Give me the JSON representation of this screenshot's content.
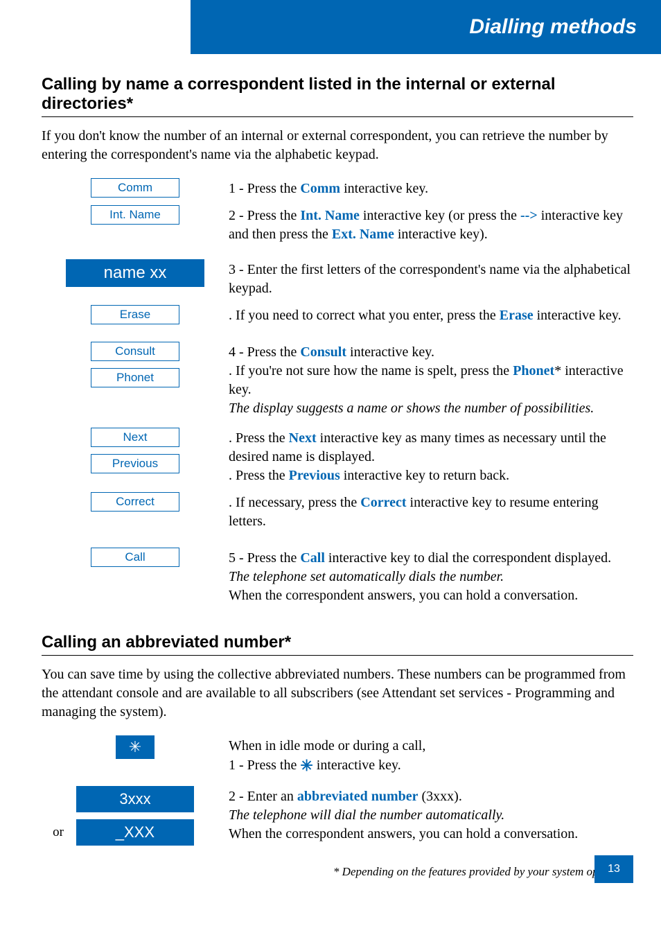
{
  "header": {
    "title": "Dialling methods"
  },
  "section1": {
    "heading": "Calling by name a correspondent listed in the internal or external directories*",
    "intro": "If you don't know the number of an internal or external correspondent, you can retrieve the number by entering the correspondent's name via the alphabetic keypad.",
    "keys": {
      "comm": "Comm",
      "int_name": "Int. Name",
      "name_display": "name xx",
      "erase": "Erase",
      "consult": "Consult",
      "phonet": "Phonet",
      "next": "Next",
      "previous": "Previous",
      "correct": "Correct",
      "call": "Call"
    },
    "steps": {
      "s1_a": "1 - Press the ",
      "s1_key": "Comm",
      "s1_b": " interactive key.",
      "s2_a": "2 - Press the ",
      "s2_key1": "Int. Name",
      "s2_b": " interactive key (or press the ",
      "s2_key2": "-->",
      "s2_c": " interactive key and then press the ",
      "s2_key3": "Ext. Name",
      "s2_d": " interactive key).",
      "s3": "3 - Enter the first letters of the correspondent's name via the alphabetical keypad.",
      "s3b_a": ". If you need to correct what you enter, press the ",
      "s3b_key": "Erase",
      "s3b_b": " interactive key.",
      "s4_a": "4 - Press the ",
      "s4_key1": "Consult",
      "s4_b": " interactive key.",
      "s4_c": ". If you're not sure how the name is spelt, press the ",
      "s4_key2": "Phonet",
      "s4_d": "* interactive key.",
      "s4_it": "The display suggests a name or shows the number of possibilities.",
      "s5_a": ". Press the ",
      "s5_key1": "Next",
      "s5_b": " interactive key as many times as necessary until the desired name is displayed.",
      "s5_c": ". Press the ",
      "s5_key2": "Previous",
      "s5_d": " interactive key to return back.",
      "s6_a": ". If necessary, press the ",
      "s6_key": "Correct",
      "s6_b": " interactive key to resume entering letters.",
      "s7_a": "5 - Press the ",
      "s7_key": "Call",
      "s7_b": " interactive key to dial the correspondent displayed.",
      "s7_it": "The telephone set automatically dials the number.",
      "s7_c": "When the correspondent answers, you can hold a conversation."
    }
  },
  "section2": {
    "heading": "Calling an abbreviated number*",
    "intro": "You can save time by using the collective abbreviated numbers. These numbers can be programmed from the attendant console and are available to all subscribers (see Attendant set services - Programming and managing the system).",
    "keys": {
      "star": "✳",
      "three": "3xxx",
      "or_label": "or",
      "underscore": "_XXX"
    },
    "steps": {
      "s1_a": "When in idle mode or during a call,",
      "s1_b": "1 - Press the ",
      "s1_star": "✳",
      "s1_c": " interactive key.",
      "s2_a": "2 - Enter an ",
      "s2_key": "abbreviated number",
      "s2_b": " (3xxx).",
      "s2_it": "The telephone will dial the number automatically.",
      "s2_c": "When the correspondent answers, you can hold a conversation."
    }
  },
  "footer": {
    "note": "* Depending on the features provided by your system operator",
    "page": "13"
  }
}
